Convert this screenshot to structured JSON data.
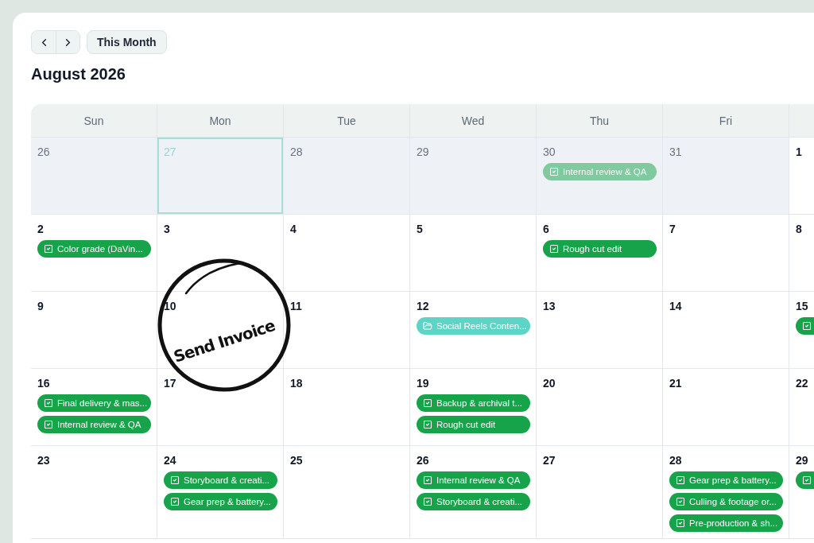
{
  "toolbar": {
    "today_button": "This Month"
  },
  "title": "August 2026",
  "weekdays": [
    "Sun",
    "Mon",
    "Tue",
    "Wed",
    "Thu",
    "Fri"
  ],
  "weeks": [
    {
      "days": [
        {
          "day": "26",
          "other_month": true,
          "selected": false
        },
        {
          "day": "27",
          "other_month": true,
          "selected": true
        },
        {
          "day": "28",
          "other_month": true,
          "selected": false
        },
        {
          "day": "29",
          "other_month": true,
          "selected": false
        },
        {
          "day": "30",
          "other_month": true,
          "selected": false,
          "events": [
            {
              "kind": "task",
              "label": "Internal review & QA"
            }
          ]
        },
        {
          "day": "31",
          "other_month": true,
          "selected": false
        },
        {
          "day": "1",
          "other_month": false,
          "selected": false
        }
      ]
    },
    {
      "days": [
        {
          "day": "2",
          "other_month": false,
          "selected": false,
          "events": [
            {
              "kind": "task",
              "label": "Color grade (DaVin..."
            }
          ]
        },
        {
          "day": "3",
          "other_month": false,
          "selected": false
        },
        {
          "day": "4",
          "other_month": false,
          "selected": false
        },
        {
          "day": "5",
          "other_month": false,
          "selected": false
        },
        {
          "day": "6",
          "other_month": false,
          "selected": false,
          "events": [
            {
              "kind": "task",
              "label": "Rough cut edit"
            }
          ]
        },
        {
          "day": "7",
          "other_month": false,
          "selected": false
        },
        {
          "day": "8",
          "other_month": false,
          "selected": false
        }
      ]
    },
    {
      "days": [
        {
          "day": "9",
          "other_month": false,
          "selected": false
        },
        {
          "day": "10",
          "other_month": false,
          "selected": false,
          "stamp": {
            "text": "Send Invoice"
          }
        },
        {
          "day": "11",
          "other_month": false,
          "selected": false
        },
        {
          "day": "12",
          "other_month": false,
          "selected": false,
          "events": [
            {
              "kind": "project",
              "label": "Social Reels Conten..."
            }
          ]
        },
        {
          "day": "13",
          "other_month": false,
          "selected": false
        },
        {
          "day": "14",
          "other_month": false,
          "selected": false
        },
        {
          "day": "15",
          "other_month": false,
          "selected": false,
          "events": [
            {
              "kind": "task"
            }
          ]
        }
      ]
    },
    {
      "days": [
        {
          "day": "16",
          "other_month": false,
          "selected": false,
          "events": [
            {
              "kind": "task",
              "label": "Final delivery & mas..."
            },
            {
              "kind": "task",
              "label": "Internal review & QA"
            }
          ]
        },
        {
          "day": "17",
          "other_month": false,
          "selected": false
        },
        {
          "day": "18",
          "other_month": false,
          "selected": false
        },
        {
          "day": "19",
          "other_month": false,
          "selected": false,
          "events": [
            {
              "kind": "task",
              "label": "Backup & archival t..."
            },
            {
              "kind": "task",
              "label": "Rough cut edit"
            }
          ]
        },
        {
          "day": "20",
          "other_month": false,
          "selected": false
        },
        {
          "day": "21",
          "other_month": false,
          "selected": false
        },
        {
          "day": "22",
          "other_month": false,
          "selected": false
        }
      ]
    },
    {
      "days": [
        {
          "day": "23",
          "other_month": false,
          "selected": false
        },
        {
          "day": "24",
          "other_month": false,
          "selected": false,
          "events": [
            {
              "kind": "task",
              "label": "Storyboard & creati..."
            },
            {
              "kind": "task",
              "label": "Gear prep & battery..."
            }
          ]
        },
        {
          "day": "25",
          "other_month": false,
          "selected": false
        },
        {
          "day": "26",
          "other_month": false,
          "selected": false,
          "events": [
            {
              "kind": "task",
              "label": "Internal review & QA"
            },
            {
              "kind": "task",
              "label": "Storyboard & creati..."
            }
          ]
        },
        {
          "day": "27",
          "other_month": false,
          "selected": false
        },
        {
          "day": "28",
          "other_month": false,
          "selected": false,
          "events": [
            {
              "kind": "task",
              "label": "Gear prep & battery..."
            },
            {
              "kind": "task",
              "label": "Culling & footage or..."
            },
            {
              "kind": "task",
              "label": "Pre-production & sh..."
            }
          ]
        },
        {
          "day": "29",
          "other_month": false,
          "selected": false,
          "events": [
            {
              "kind": "task"
            }
          ]
        }
      ]
    }
  ]
}
